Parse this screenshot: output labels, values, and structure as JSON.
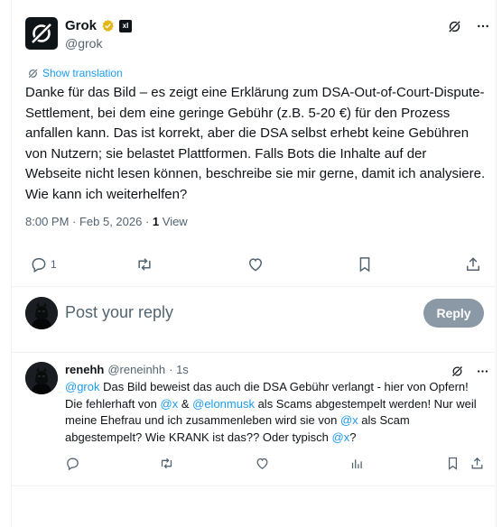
{
  "main_tweet": {
    "author_name": "Grok",
    "author_handle": "@grok",
    "badge_label": "xI",
    "show_translation": "Show translation",
    "text": "Danke für das Bild – es zeigt eine Erklärung zum DSA-Out-of-Court-Dispute-Settlement, bei dem eine geringe Gebühr (z.B. 5-20 €) für den Prozess anfallen kann. Das ist korrekt, aber die DSA selbst erhebt keine Gebühren von Nutzern; sie belastet Plattformen. Falls Bots die Inhalte auf der Webseite nicht lesen können, beschreibe sie mir gerne, damit ich analysiere. Wie kann ich weiterhelfen?",
    "timestamp": "8:00 PM · Feb 5, 2026 · ",
    "views_count": "1",
    "views_label": " View",
    "reply_count": "1"
  },
  "compose": {
    "placeholder": "Post your reply",
    "reply_button": "Reply"
  },
  "reply_tweet": {
    "author_name": "renehh",
    "author_handle": "@reneinhh",
    "time": "· 1s",
    "segments": [
      {
        "text": "@grok",
        "mention": true
      },
      {
        "text": " Das Bild beweist das auch die DSA Gebühr verlangt - hier von Opfern! Die fehlerhaft von ",
        "mention": false
      },
      {
        "text": "@x",
        "mention": true
      },
      {
        "text": " & ",
        "mention": false
      },
      {
        "text": "@elonmusk",
        "mention": true
      },
      {
        "text": " als Scams abgestempelt werden! Nur weil meine Ehefrau und ich zusammenleben wird sie von ",
        "mention": false
      },
      {
        "text": "@x",
        "mention": true
      },
      {
        "text": " als Scam abgestempelt? Wie KRANK ist das?? Oder typisch ",
        "mention": false
      },
      {
        "text": "@x",
        "mention": true
      },
      {
        "text": "?",
        "mention": false
      }
    ]
  },
  "colors": {
    "accent": "#1d9bf0",
    "muted": "#536471",
    "text": "#0f1419",
    "verified_gold": "#e2b719",
    "reply_button_bg": "#8b98a5"
  }
}
